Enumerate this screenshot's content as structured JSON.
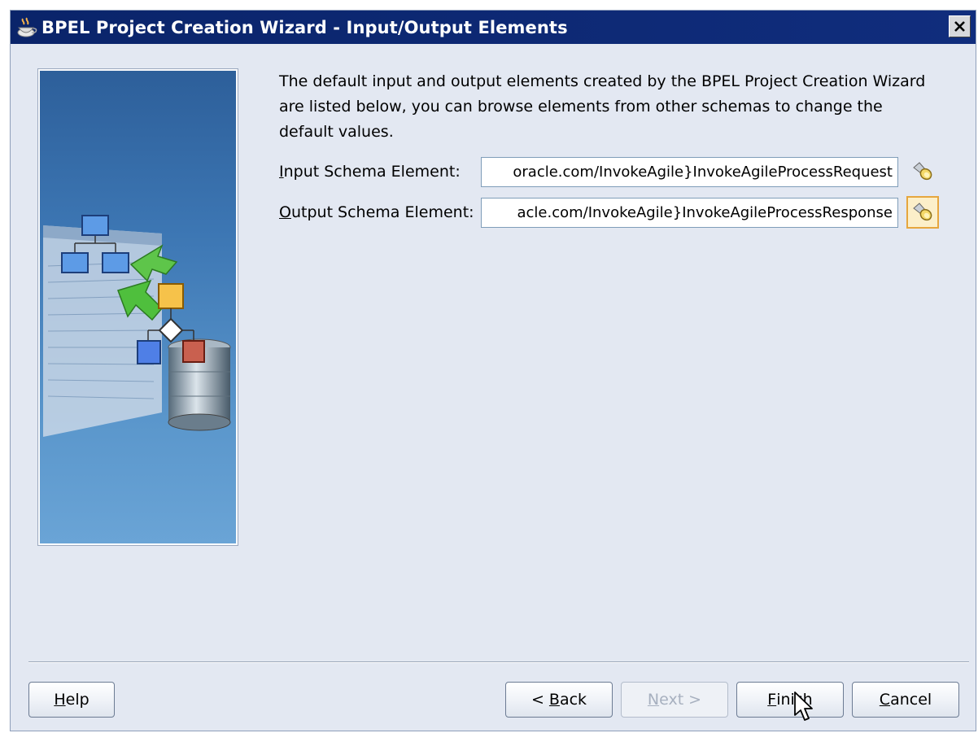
{
  "window": {
    "title": "BPEL Project Creation Wizard - Input/Output Elements",
    "title_bar_color": "#0a246a",
    "background_color": "#e3e8f2"
  },
  "icons": {
    "app": "coffee-cup-icon",
    "close": "close-icon",
    "browse": "flashlight-icon",
    "cursor": "mouse-pointer-icon"
  },
  "description": "The default input and output elements created by the BPEL Project Creation Wizard are listed below, you can browse elements from other schemas to change the default values.",
  "fields": {
    "input": {
      "label_mnemonic": "I",
      "label_rest": "nput Schema Element:",
      "value": "oracle.com/InvokeAgile}InvokeAgileProcessRequest"
    },
    "output": {
      "label_mnemonic": "O",
      "label_rest": "utput Schema Element:",
      "value": "acle.com/InvokeAgile}InvokeAgileProcessResponse"
    }
  },
  "buttons": {
    "help": {
      "mnemonic": "H",
      "rest": "elp"
    },
    "back": {
      "pre": "< ",
      "mnemonic": "B",
      "rest": "ack"
    },
    "next": {
      "mnemonic": "N",
      "rest": "ext >"
    },
    "finish": {
      "mnemonic": "F",
      "rest": "inish"
    },
    "cancel": {
      "mnemonic": "C",
      "rest": "ancel"
    }
  }
}
